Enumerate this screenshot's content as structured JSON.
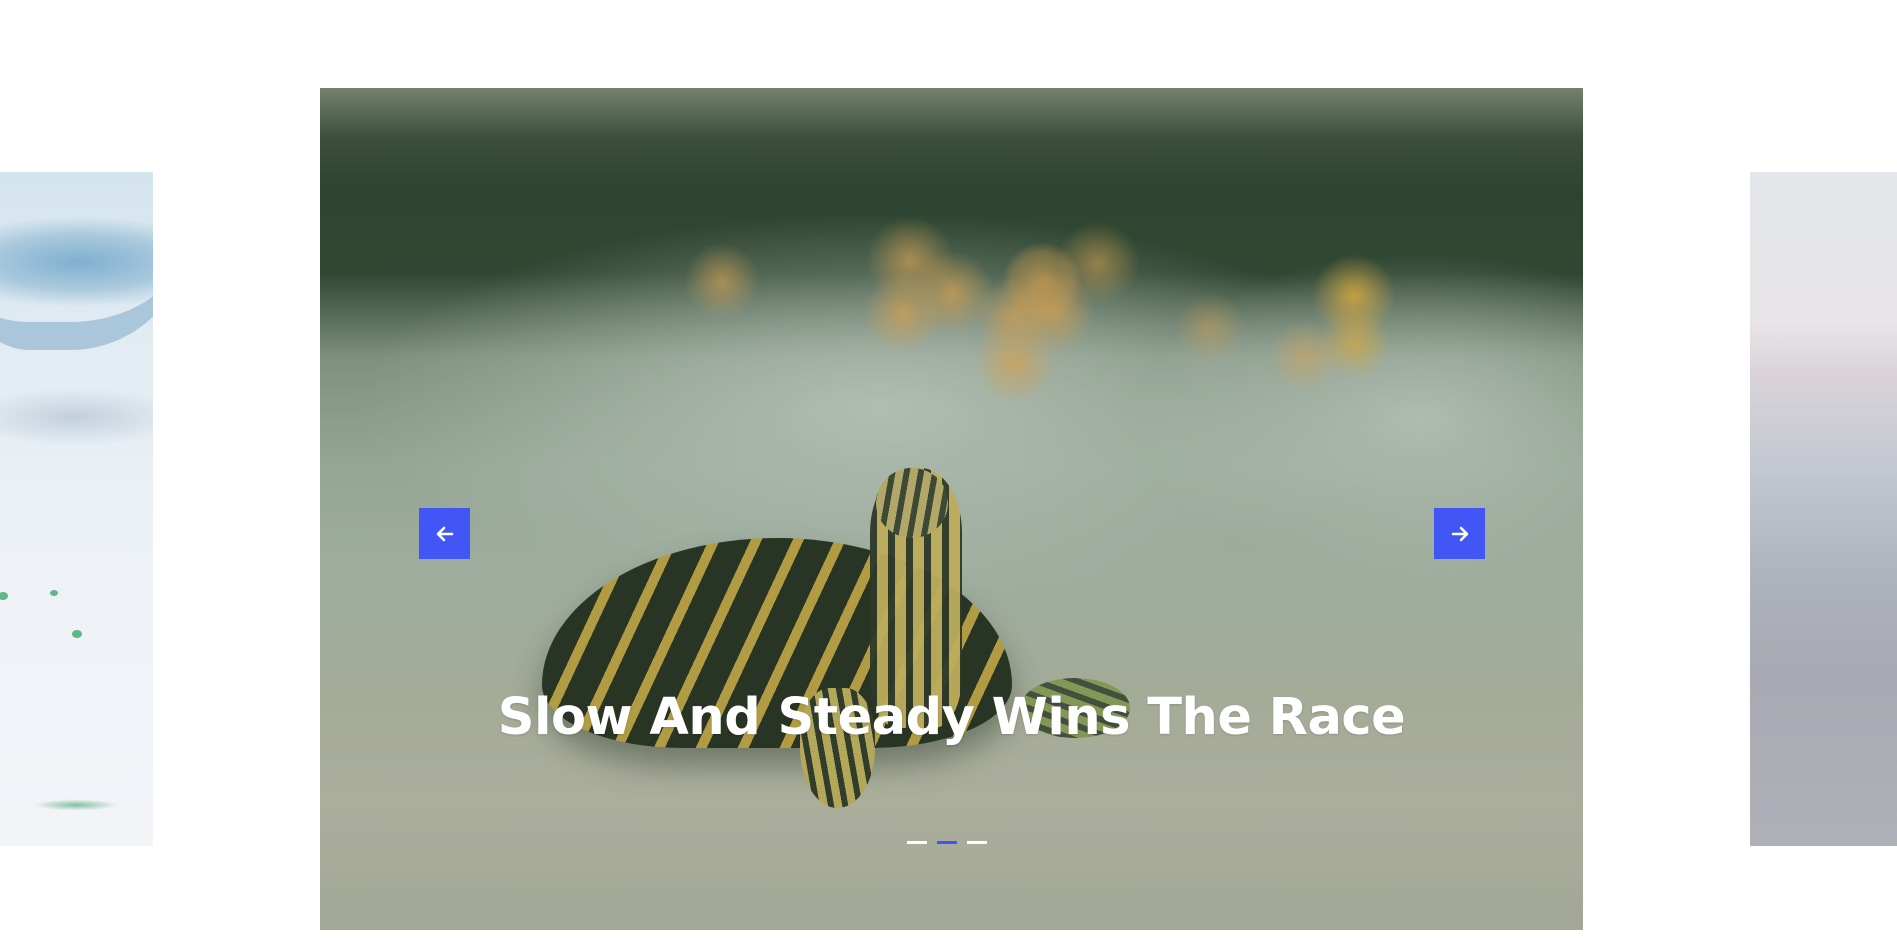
{
  "carousel": {
    "caption": "Slow And Steady Wins The Race",
    "prev_icon": "arrow-left-icon",
    "next_icon": "arrow-right-icon",
    "accent_color": "#4255f5",
    "indicators": {
      "count": 3,
      "active_index": 1
    },
    "slides": [
      {
        "position": "previous",
        "image": "blue-white-bowl-photo"
      },
      {
        "position": "current",
        "image": "turtle-on-wood-photo"
      },
      {
        "position": "next",
        "image": "pale-sky-photo"
      }
    ]
  }
}
